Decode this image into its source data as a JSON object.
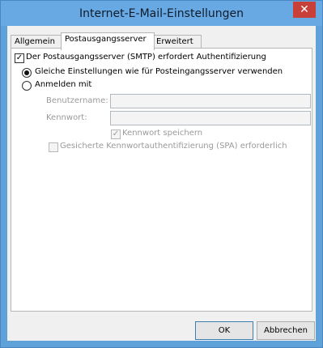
{
  "window": {
    "title": "Internet-E-Mail-Einstellungen",
    "close_symbol": "✕"
  },
  "tabs": [
    {
      "label": "Allgemein"
    },
    {
      "label": "Postausgangsserver"
    },
    {
      "label": "Erweitert"
    }
  ],
  "smtp_auth": {
    "label": "Der Postausgangsserver (SMTP) erfordert Authentifizierung",
    "checked": true
  },
  "radio_same": {
    "label": "Gleiche Einstellungen wie für Posteingangsserver verwenden",
    "selected": true
  },
  "radio_login": {
    "label": "Anmelden mit",
    "selected": false
  },
  "username": {
    "label": "Benutzername:",
    "value": ""
  },
  "password": {
    "label": "Kennwort:",
    "value": ""
  },
  "save_password": {
    "label": "Kennwort speichern",
    "checked": true
  },
  "spa": {
    "label": "Gesicherte Kennwortauthentifizierung (SPA) erforderlich",
    "checked": false
  },
  "buttons": {
    "ok": "OK",
    "cancel": "Abbrechen"
  },
  "colors": {
    "titlebar": "#69a9e3",
    "close": "#c7403a"
  }
}
